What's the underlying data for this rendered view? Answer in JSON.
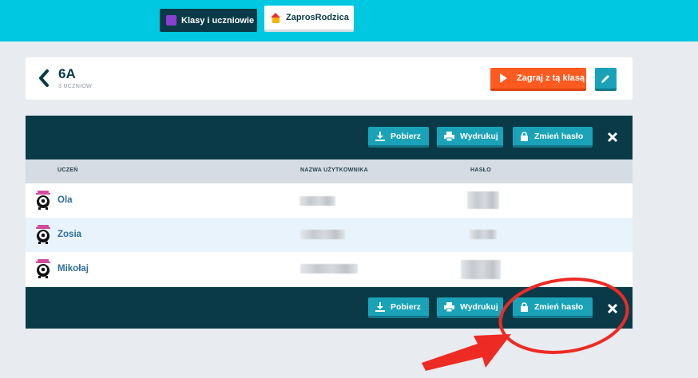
{
  "nav": {
    "tab_classes": "Klasy i uczniowie",
    "tab_parents": "ZaprosRodzica"
  },
  "class_card": {
    "name": "6A",
    "student_count": "3 UCZNIOW",
    "play_label": "Zagraj z tą klasą"
  },
  "toolbar": {
    "download_label": "Pobierz",
    "print_label": "Wydrukuj",
    "change_password_label": "Zmień hasło"
  },
  "table": {
    "columns": [
      "UCZEŃ",
      "NAZWA UŻYTKOWNIKA",
      "HASŁO"
    ],
    "rows": [
      {
        "student": "Ola"
      },
      {
        "student": "Zosia"
      },
      {
        "student": "Mikołaj"
      }
    ]
  },
  "colors": {
    "topbar": "#00c8e0",
    "dark_panel": "#0a3a47",
    "button_teal": "#1aa3b8",
    "play_orange": "#ff5a1f",
    "annotation_red": "#ee2a24"
  }
}
